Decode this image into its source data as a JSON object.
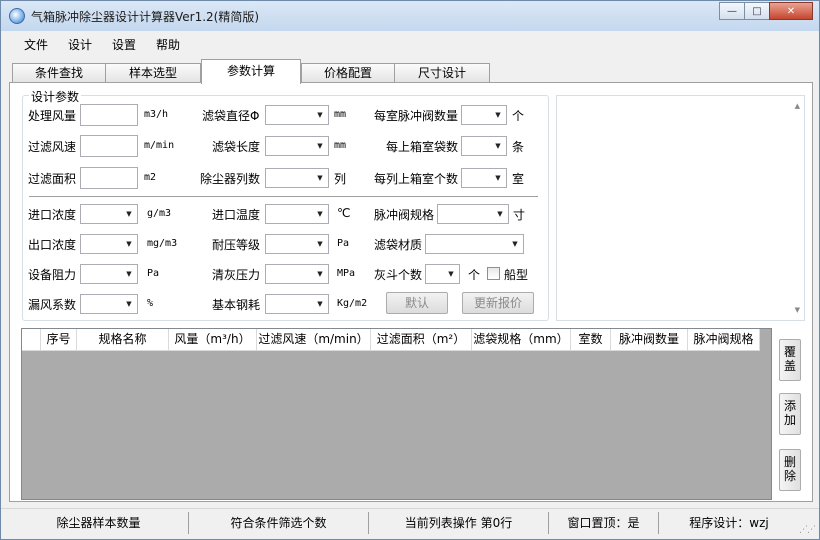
{
  "window": {
    "title": "气箱脉冲除尘器设计计算器Ver1.2(精简版)",
    "minimize_glyph": "—",
    "maximize_glyph": "□",
    "close_glyph": "✕"
  },
  "menu": [
    "文件",
    "设计",
    "设置",
    "帮助"
  ],
  "tabs": [
    "条件查找",
    "样本选型",
    "参数计算",
    "价格配置",
    "尺寸设计"
  ],
  "group_title": "设计参数",
  "fields": {
    "air_volume": {
      "label": "处理风量",
      "unit": "m3/h"
    },
    "filter_velocity": {
      "label": "过滤风速",
      "unit": "m/min"
    },
    "filter_area": {
      "label": "过滤面积",
      "unit": "m2"
    },
    "bag_diameter": {
      "label": "滤袋直径Φ",
      "unit": "mm"
    },
    "bag_length": {
      "label": "滤袋长度",
      "unit": "mm"
    },
    "columns": {
      "label": "除尘器列数",
      "unit": "列"
    },
    "valves_per_chamber": {
      "label": "每室脉冲阀数量",
      "unit": "个"
    },
    "bags_per_box": {
      "label": "每上箱室袋数",
      "unit": "条"
    },
    "boxes_per_column": {
      "label": "每列上箱室个数",
      "unit": "室"
    },
    "inlet_concentration": {
      "label": "进口浓度",
      "unit": "g/m3"
    },
    "outlet_concentration": {
      "label": "出口浓度",
      "unit": "mg/m3"
    },
    "resistance": {
      "label": "设备阻力",
      "unit": "Pa"
    },
    "leak_coefficient": {
      "label": "漏风系数",
      "unit": "%"
    },
    "inlet_temperature": {
      "label": "进口温度",
      "unit": "℃"
    },
    "pressure_grade": {
      "label": "耐压等级",
      "unit": "Pa"
    },
    "cleaning_pressure": {
      "label": "清灰压力",
      "unit": "MPa"
    },
    "base_steel": {
      "label": "基本钢耗",
      "unit": "Kg/m2"
    },
    "valve_spec": {
      "label": "脉冲阀规格",
      "unit": "寸"
    },
    "bag_material": {
      "label": "滤袋材质"
    },
    "hopper_count": {
      "label": "灰斗个数",
      "unit": "个"
    },
    "ship_type": {
      "label": "船型"
    }
  },
  "buttons": {
    "default": "默认",
    "update_quote": "更新报价"
  },
  "grid_headers": [
    "序号",
    "规格名称",
    "风量（m³/h）",
    "过滤风速（m/min）",
    "过滤面积（m²）",
    "滤袋规格（mm）",
    "室数",
    "脉冲阀数量",
    "脉冲阀规格"
  ],
  "side_buttons": {
    "cover": [
      "覆",
      "盖"
    ],
    "add": [
      "添",
      "加"
    ],
    "delete": [
      "删",
      "除"
    ]
  },
  "status": {
    "sample_count": "除尘器样本数量",
    "filter_count": "符合条件筛选个数",
    "current_op": "当前列表操作 第0行",
    "on_top": "窗口置顶：是",
    "designer": "程序设计：wzj"
  }
}
